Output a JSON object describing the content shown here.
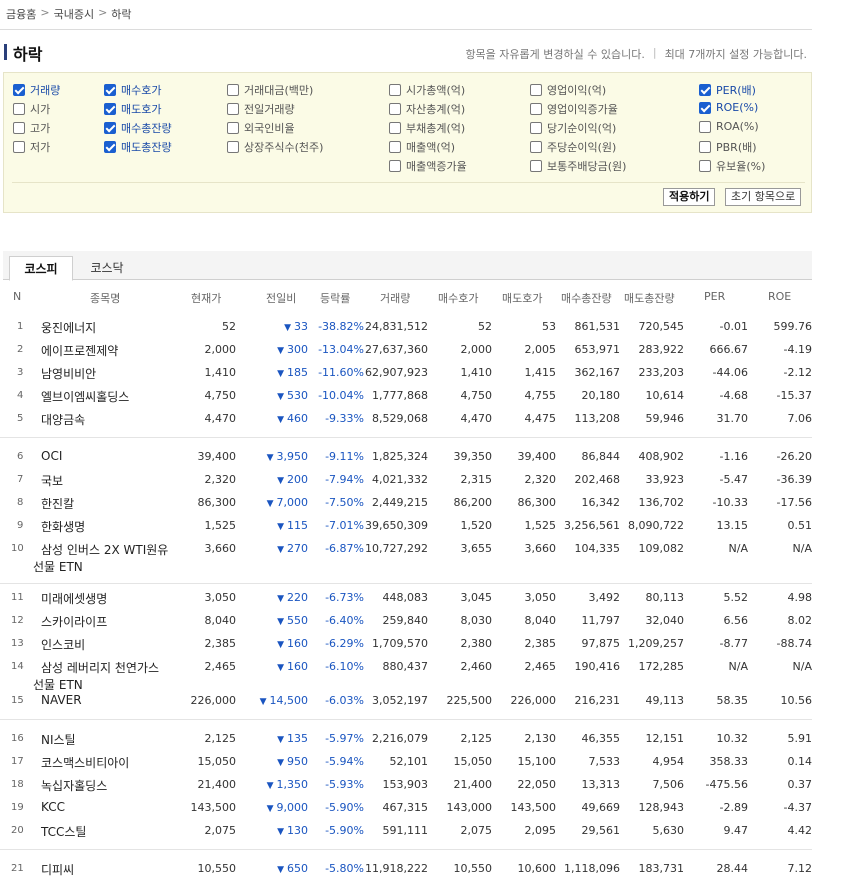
{
  "breadcrumb": [
    "금융홈",
    "국내증시",
    "하락"
  ],
  "page_title": "하락",
  "hint": [
    "항목을 자유롭게 변경하실 수 있습니다.",
    "최대 7개까지 설정 가능합니다."
  ],
  "options": [
    {
      "label": "거래량",
      "checked": true
    },
    {
      "label": "시가",
      "checked": false
    },
    {
      "label": "고가",
      "checked": false
    },
    {
      "label": "저가",
      "checked": false
    },
    {
      "label": "매수호가",
      "checked": true
    },
    {
      "label": "매도호가",
      "checked": true
    },
    {
      "label": "매수총잔량",
      "checked": true
    },
    {
      "label": "매도총잔량",
      "checked": true
    },
    {
      "label": "거래대금(백만)",
      "checked": false
    },
    {
      "label": "전일거래량",
      "checked": false
    },
    {
      "label": "외국인비율",
      "checked": false
    },
    {
      "label": "상장주식수(천주)",
      "checked": false
    },
    {
      "label": "시가총액(억)",
      "checked": false
    },
    {
      "label": "자산총계(억)",
      "checked": false
    },
    {
      "label": "부채총계(억)",
      "checked": false
    },
    {
      "label": "매출액(억)",
      "checked": false
    },
    {
      "label": "매출액증가율",
      "checked": false
    },
    {
      "label": "영업이익(억)",
      "checked": false
    },
    {
      "label": "영업이익증가율",
      "checked": false
    },
    {
      "label": "당기순이익(억)",
      "checked": false
    },
    {
      "label": "주당순이익(원)",
      "checked": false
    },
    {
      "label": "보통주배당금(원)",
      "checked": false
    },
    {
      "label": "PER(배)",
      "checked": true
    },
    {
      "label": "ROE(%)",
      "checked": true
    },
    {
      "label": "ROA(%)",
      "checked": false
    },
    {
      "label": "PBR(배)",
      "checked": false
    },
    {
      "label": "유보율(%)",
      "checked": false
    }
  ],
  "buttons": {
    "apply": "적용하기",
    "reset": "초기 항목으로"
  },
  "tabs": [
    "코스피",
    "코스닥"
  ],
  "columns": [
    "N",
    "종목명",
    "현재가",
    "전일비",
    "등락률",
    "거래량",
    "매수호가",
    "매도호가",
    "매수총잔량",
    "매도총잔량",
    "PER",
    "ROE"
  ],
  "change_arrow": "▼",
  "rows": [
    {
      "n": "1",
      "name": "웅진에너지",
      "name2": "",
      "price": "52",
      "diff": "33",
      "rate": "-38.82%",
      "vol": "24,831,512",
      "bid": "52",
      "ask": "53",
      "bidq": "861,531",
      "askq": "720,545",
      "per": "-0.01",
      "roe": "599.76"
    },
    {
      "n": "2",
      "name": "에이프로젠제약",
      "name2": "",
      "price": "2,000",
      "diff": "300",
      "rate": "-13.04%",
      "vol": "27,637,360",
      "bid": "2,000",
      "ask": "2,005",
      "bidq": "653,971",
      "askq": "283,922",
      "per": "666.67",
      "roe": "-4.19"
    },
    {
      "n": "3",
      "name": "남영비비안",
      "name2": "",
      "price": "1,410",
      "diff": "185",
      "rate": "-11.60%",
      "vol": "62,907,923",
      "bid": "1,410",
      "ask": "1,415",
      "bidq": "362,167",
      "askq": "233,203",
      "per": "-44.06",
      "roe": "-2.12"
    },
    {
      "n": "4",
      "name": "엘브이엠씨홀딩스",
      "name2": "",
      "price": "4,750",
      "diff": "530",
      "rate": "-10.04%",
      "vol": "1,777,868",
      "bid": "4,750",
      "ask": "4,755",
      "bidq": "20,180",
      "askq": "10,614",
      "per": "-4.68",
      "roe": "-15.37"
    },
    {
      "n": "5",
      "name": "대양금속",
      "name2": "",
      "price": "4,470",
      "diff": "460",
      "rate": "-9.33%",
      "vol": "8,529,068",
      "bid": "4,470",
      "ask": "4,475",
      "bidq": "113,208",
      "askq": "59,946",
      "per": "31.70",
      "roe": "7.06"
    },
    {
      "n": "6",
      "name": "OCI",
      "name2": "",
      "price": "39,400",
      "diff": "3,950",
      "rate": "-9.11%",
      "vol": "1,825,324",
      "bid": "39,350",
      "ask": "39,400",
      "bidq": "86,844",
      "askq": "408,902",
      "per": "-1.16",
      "roe": "-26.20"
    },
    {
      "n": "7",
      "name": "국보",
      "name2": "",
      "price": "2,320",
      "diff": "200",
      "rate": "-7.94%",
      "vol": "4,021,332",
      "bid": "2,315",
      "ask": "2,320",
      "bidq": "202,468",
      "askq": "33,923",
      "per": "-5.47",
      "roe": "-36.39"
    },
    {
      "n": "8",
      "name": "한진칼",
      "name2": "",
      "price": "86,300",
      "diff": "7,000",
      "rate": "-7.50%",
      "vol": "2,449,215",
      "bid": "86,200",
      "ask": "86,300",
      "bidq": "16,342",
      "askq": "136,702",
      "per": "-10.33",
      "roe": "-17.56"
    },
    {
      "n": "9",
      "name": "한화생명",
      "name2": "",
      "price": "1,525",
      "diff": "115",
      "rate": "-7.01%",
      "vol": "39,650,309",
      "bid": "1,520",
      "ask": "1,525",
      "bidq": "3,256,561",
      "askq": "8,090,722",
      "per": "13.15",
      "roe": "0.51"
    },
    {
      "n": "10",
      "name": "삼성 인버스 2X WTI원유",
      "name2": "선물 ETN",
      "price": "3,660",
      "diff": "270",
      "rate": "-6.87%",
      "vol": "10,727,292",
      "bid": "3,655",
      "ask": "3,660",
      "bidq": "104,335",
      "askq": "109,082",
      "per": "N/A",
      "roe": "N/A"
    },
    {
      "n": "11",
      "name": "미래에셋생명",
      "name2": "",
      "price": "3,050",
      "diff": "220",
      "rate": "-6.73%",
      "vol": "448,083",
      "bid": "3,045",
      "ask": "3,050",
      "bidq": "3,492",
      "askq": "80,113",
      "per": "5.52",
      "roe": "4.98"
    },
    {
      "n": "12",
      "name": "스카이라이프",
      "name2": "",
      "price": "8,040",
      "diff": "550",
      "rate": "-6.40%",
      "vol": "259,840",
      "bid": "8,030",
      "ask": "8,040",
      "bidq": "11,797",
      "askq": "32,040",
      "per": "6.56",
      "roe": "8.02"
    },
    {
      "n": "13",
      "name": "인스코비",
      "name2": "",
      "price": "2,385",
      "diff": "160",
      "rate": "-6.29%",
      "vol": "1,709,570",
      "bid": "2,380",
      "ask": "2,385",
      "bidq": "97,875",
      "askq": "1,209,257",
      "per": "-8.77",
      "roe": "-88.74"
    },
    {
      "n": "14",
      "name": "삼성 레버리지 천연가스",
      "name2": "선물 ETN",
      "price": "2,465",
      "diff": "160",
      "rate": "-6.10%",
      "vol": "880,437",
      "bid": "2,460",
      "ask": "2,465",
      "bidq": "190,416",
      "askq": "172,285",
      "per": "N/A",
      "roe": "N/A"
    },
    {
      "n": "15",
      "name": "NAVER",
      "name2": "",
      "price": "226,000",
      "diff": "14,500",
      "rate": "-6.03%",
      "vol": "3,052,197",
      "bid": "225,500",
      "ask": "226,000",
      "bidq": "216,231",
      "askq": "49,113",
      "per": "58.35",
      "roe": "10.56"
    },
    {
      "n": "16",
      "name": "NI스틸",
      "name2": "",
      "price": "2,125",
      "diff": "135",
      "rate": "-5.97%",
      "vol": "2,216,079",
      "bid": "2,125",
      "ask": "2,130",
      "bidq": "46,355",
      "askq": "12,151",
      "per": "10.32",
      "roe": "5.91"
    },
    {
      "n": "17",
      "name": "코스맥스비티아이",
      "name2": "",
      "price": "15,050",
      "diff": "950",
      "rate": "-5.94%",
      "vol": "52,101",
      "bid": "15,050",
      "ask": "15,100",
      "bidq": "7,533",
      "askq": "4,954",
      "per": "358.33",
      "roe": "0.14"
    },
    {
      "n": "18",
      "name": "녹십자홀딩스",
      "name2": "",
      "price": "21,400",
      "diff": "1,350",
      "rate": "-5.93%",
      "vol": "153,903",
      "bid": "21,400",
      "ask": "22,050",
      "bidq": "13,313",
      "askq": "7,506",
      "per": "-475.56",
      "roe": "0.37"
    },
    {
      "n": "19",
      "name": "KCC",
      "name2": "",
      "price": "143,500",
      "diff": "9,000",
      "rate": "-5.90%",
      "vol": "467,315",
      "bid": "143,000",
      "ask": "143,500",
      "bidq": "49,669",
      "askq": "128,943",
      "per": "-2.89",
      "roe": "-4.37"
    },
    {
      "n": "20",
      "name": "TCC스틸",
      "name2": "",
      "price": "2,075",
      "diff": "130",
      "rate": "-5.90%",
      "vol": "591,111",
      "bid": "2,075",
      "ask": "2,095",
      "bidq": "29,561",
      "askq": "5,630",
      "per": "9.47",
      "roe": "4.42"
    },
    {
      "n": "21",
      "name": "디피씨",
      "name2": "",
      "price": "10,550",
      "diff": "650",
      "rate": "-5.80%",
      "vol": "11,918,222",
      "bid": "10,550",
      "ask": "10,600",
      "bidq": "1,118,096",
      "askq": "183,731",
      "per": "28.44",
      "roe": "7.12"
    }
  ]
}
